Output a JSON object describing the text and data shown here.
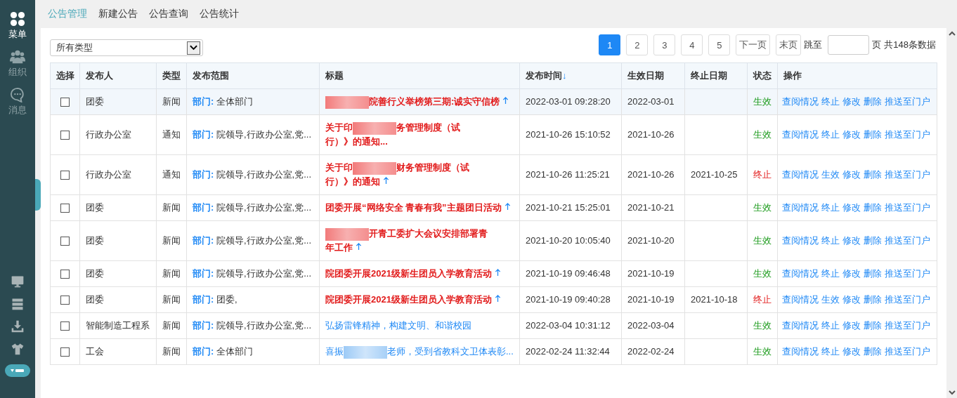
{
  "sidebar": {
    "items": [
      {
        "label": "菜单",
        "selected": true
      },
      {
        "label": "组织",
        "selected": false
      },
      {
        "label": "消息",
        "selected": false
      }
    ]
  },
  "tabs": [
    {
      "label": "公告管理",
      "selected": true
    },
    {
      "label": "新建公告",
      "selected": false
    },
    {
      "label": "公告查询",
      "selected": false
    },
    {
      "label": "公告统计",
      "selected": false
    }
  ],
  "filter": {
    "value": "所有类型"
  },
  "pagination": {
    "pages": [
      {
        "label": "1",
        "selected": true
      },
      {
        "label": "2",
        "selected": false
      },
      {
        "label": "3",
        "selected": false
      },
      {
        "label": "4",
        "selected": false
      },
      {
        "label": "5",
        "selected": false
      }
    ],
    "next": "下一页",
    "last": "末页",
    "jump_label": "跳至",
    "page_unit": "页",
    "total": "共148条数据"
  },
  "table": {
    "columns": [
      {
        "label": "选择"
      },
      {
        "label": "发布人"
      },
      {
        "label": "类型"
      },
      {
        "label": "发布范围"
      },
      {
        "label": "标题"
      },
      {
        "label": "发布时间",
        "sort": "↓"
      },
      {
        "label": "生效日期"
      },
      {
        "label": "终止日期"
      },
      {
        "label": "状态"
      },
      {
        "label": "操作"
      }
    ],
    "rows": [
      {
        "hovered": true,
        "checked": false,
        "publisher": "团委",
        "type": "新闻",
        "scope_label": "部门:",
        "scope": "全体部门",
        "important": true,
        "pinned": true,
        "title": [
          {
            "kind": "redacted"
          },
          {
            "kind": "text",
            "text": "院善行义举榜第三期:诚实守信榜"
          }
        ],
        "time": "2022-03-01 09:28:20",
        "start": "2022-03-01",
        "end": "",
        "status": {
          "kind": "active",
          "label": "生效"
        },
        "actions": [
          "查阅情况",
          "终止",
          "修改",
          "删除",
          "推送至门户"
        ]
      },
      {
        "hovered": false,
        "checked": false,
        "publisher": "行政办公室",
        "type": "通知",
        "scope_label": "部门:",
        "scope": "院领导,行政办公室,党...",
        "important": true,
        "pinned": false,
        "title": [
          {
            "kind": "text",
            "text": "关于印"
          },
          {
            "kind": "redacted"
          },
          {
            "kind": "text",
            "text": "务管理制度（试"
          },
          {
            "kind": "text",
            "text": "行）》的通知..."
          }
        ],
        "time": "2021-10-26 15:10:52",
        "start": "2021-10-26",
        "end": "",
        "status": {
          "kind": "active",
          "label": "生效"
        },
        "actions": [
          "查阅情况",
          "终止",
          "修改",
          "删除",
          "推送至门户"
        ]
      },
      {
        "hovered": false,
        "checked": false,
        "publisher": "行政办公室",
        "type": "通知",
        "scope_label": "部门:",
        "scope": "院领导,行政办公室,党...",
        "important": true,
        "pinned": true,
        "title": [
          {
            "kind": "text",
            "text": "关于印"
          },
          {
            "kind": "redacted"
          },
          {
            "kind": "text",
            "text": "财务管理制度（试"
          },
          {
            "kind": "text",
            "text": "行）》的通知"
          }
        ],
        "time": "2021-10-26 11:25:21",
        "start": "2021-10-26",
        "end": "2021-10-25",
        "status": {
          "kind": "stopped",
          "label": "终止"
        },
        "actions": [
          "查阅情况",
          "生效",
          "修改",
          "删除",
          "推送至门户"
        ]
      },
      {
        "hovered": false,
        "checked": false,
        "publisher": "团委",
        "type": "新闻",
        "scope_label": "部门:",
        "scope": "院领导,行政办公室,党...",
        "important": true,
        "pinned": true,
        "title": [
          {
            "kind": "text",
            "text": "团委开展“网络安全 青春有我”主题团日活动"
          }
        ],
        "time": "2021-10-21 15:25:01",
        "start": "2021-10-21",
        "end": "",
        "status": {
          "kind": "active",
          "label": "生效"
        },
        "actions": [
          "查阅情况",
          "终止",
          "修改",
          "删除",
          "推送至门户"
        ]
      },
      {
        "hovered": false,
        "checked": false,
        "publisher": "团委",
        "type": "新闻",
        "scope_label": "部门:",
        "scope": "院领导,行政办公室,党...",
        "important": true,
        "pinned": true,
        "title": [
          {
            "kind": "redacted"
          },
          {
            "kind": "text",
            "text": "开青工委扩大会议安排部署青"
          },
          {
            "kind": "text",
            "text": "年工作"
          }
        ],
        "time": "2021-10-20 10:05:40",
        "start": "2021-10-20",
        "end": "",
        "status": {
          "kind": "active",
          "label": "生效"
        },
        "actions": [
          "查阅情况",
          "终止",
          "修改",
          "删除",
          "推送至门户"
        ]
      },
      {
        "hovered": false,
        "checked": false,
        "publisher": "团委",
        "type": "新闻",
        "scope_label": "部门:",
        "scope": "院领导,行政办公室,党...",
        "important": true,
        "pinned": true,
        "title": [
          {
            "kind": "text",
            "text": "院团委开展2021级新生团员入学教育活动"
          }
        ],
        "time": "2021-10-19 09:46:48",
        "start": "2021-10-19",
        "end": "",
        "status": {
          "kind": "active",
          "label": "生效"
        },
        "actions": [
          "查阅情况",
          "终止",
          "修改",
          "删除",
          "推送至门户"
        ]
      },
      {
        "hovered": false,
        "checked": false,
        "publisher": "团委",
        "type": "新闻",
        "scope_label": "部门:",
        "scope": "团委,",
        "important": true,
        "pinned": true,
        "title": [
          {
            "kind": "text",
            "text": "院团委开展2021级新生团员入学教育活动"
          }
        ],
        "time": "2021-10-19 09:40:28",
        "start": "2021-10-19",
        "end": "2021-10-18",
        "status": {
          "kind": "stopped",
          "label": "终止"
        },
        "actions": [
          "查阅情况",
          "生效",
          "修改",
          "删除",
          "推送至门户"
        ]
      },
      {
        "hovered": false,
        "checked": false,
        "publisher": "智能制造工程系",
        "type": "新闻",
        "scope_label": "部门:",
        "scope": "院领导,行政办公室,党...",
        "important": false,
        "pinned": false,
        "title": [
          {
            "kind": "text",
            "text": "弘扬雷锋精神，构建文明、和谐校园"
          }
        ],
        "time": "2022-03-04 10:31:12",
        "start": "2022-03-04",
        "end": "",
        "status": {
          "kind": "active",
          "label": "生效"
        },
        "actions": [
          "查阅情况",
          "终止",
          "修改",
          "删除",
          "推送至门户"
        ]
      },
      {
        "hovered": false,
        "checked": false,
        "publisher": "工会",
        "type": "新闻",
        "scope_label": "部门:",
        "scope": "全体部门",
        "important": false,
        "pinned": false,
        "title": [
          {
            "kind": "text",
            "text": "喜振"
          },
          {
            "kind": "redacted"
          },
          {
            "kind": "text",
            "text": "老师，受到省教科"
          },
          {
            "kind": "text",
            "text": "文卫体表彰..."
          }
        ],
        "time": "2022-02-24 11:32:44",
        "start": "2022-02-24",
        "end": "",
        "status": {
          "kind": "active",
          "label": "生效"
        },
        "actions": [
          "查阅情况",
          "终止",
          "修改",
          "删除",
          "推送至门户"
        ]
      }
    ]
  }
}
